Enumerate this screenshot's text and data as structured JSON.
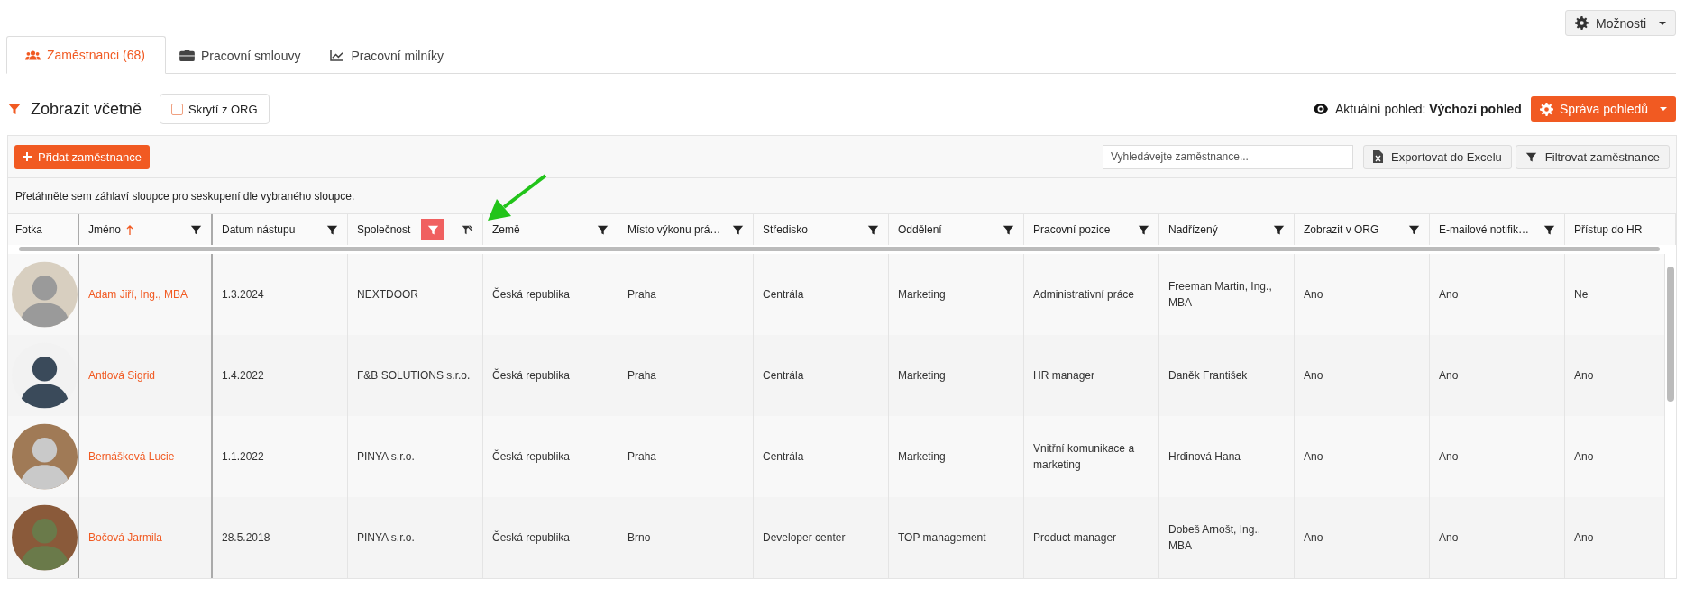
{
  "options_button": {
    "label": "Možnosti"
  },
  "tabs": [
    {
      "label": "Zaměstnanci (68)",
      "selected": true
    },
    {
      "label": "Pracovní smlouvy",
      "selected": false
    },
    {
      "label": "Pracovní milníky",
      "selected": false
    }
  ],
  "filter_bar": {
    "title": "Zobrazit včetně",
    "checkbox": {
      "label": "Skrytí z ORG",
      "checked": false
    }
  },
  "current_view": {
    "label": "Aktuální pohled:",
    "value": "Výchozí pohled"
  },
  "manage_views_button": {
    "label": "Správa pohledů"
  },
  "toolbar": {
    "add_button": "Přidat zaměstnance",
    "search": {
      "placeholder": "Vyhledávejte zaměstnance..."
    },
    "export_button": "Exportovat do Excelu",
    "filter_button": "Filtrovat zaměstnance"
  },
  "group_hint": "Přetáhněte sem záhlaví sloupce pro seskupení dle vybraného sloupce.",
  "table": {
    "columns": [
      {
        "label": "Fotka"
      },
      {
        "label": "Jméno",
        "sorted_ascending": true,
        "filter_active": false
      },
      {
        "label": "Datum nástupu",
        "filter_active": false
      },
      {
        "label": "Společnost",
        "filter_active": true
      },
      {
        "label": "Země",
        "filter_active": false
      },
      {
        "label": "Místo výkonu prá…",
        "filter_active": false
      },
      {
        "label": "Středisko",
        "filter_active": false
      },
      {
        "label": "Oddělení",
        "filter_active": false
      },
      {
        "label": "Pracovní pozice",
        "filter_active": false
      },
      {
        "label": "Nadřízený",
        "filter_active": false
      },
      {
        "label": "Zobrazit v ORG",
        "filter_active": false
      },
      {
        "label": "E-mailové notifik…",
        "filter_active": false
      },
      {
        "label": "Přístup do HR"
      }
    ],
    "rows": [
      {
        "cells": [
          "",
          "Adam Jiří, Ing., MBA",
          "1.3.2024",
          "NEXTDOOR",
          "Česká republika",
          "Praha",
          "Centrála",
          "Marketing",
          "Administrativní práce",
          "Freeman Martin, Ing., MBA",
          "Ano",
          "Ano",
          "Ne"
        ]
      },
      {
        "cells": [
          "",
          "Antlová Sigrid",
          "1.4.2022",
          "F&B SOLUTIONS s.r.o.",
          "Česká republika",
          "Praha",
          "Centrála",
          "Marketing",
          "HR manager",
          "Daněk František",
          "Ano",
          "Ano",
          "Ano"
        ]
      },
      {
        "cells": [
          "",
          "Bernášková Lucie",
          "1.1.2022",
          "PINYA s.r.o.",
          "Česká republika",
          "Praha",
          "Centrála",
          "Marketing",
          "Vnitřní komunikace a marketing",
          "Hrdinová Hana",
          "Ano",
          "Ano",
          "Ano"
        ]
      },
      {
        "cells": [
          "",
          "Bočová Jarmila",
          "28.5.2018",
          "PINYA s.r.o.",
          "Česká republika",
          "Brno",
          "Developer center",
          "TOP management",
          "Product manager",
          "Dobeš Arnošt, Ing., MBA",
          "Ano",
          "Ano",
          "Ano"
        ]
      }
    ]
  }
}
